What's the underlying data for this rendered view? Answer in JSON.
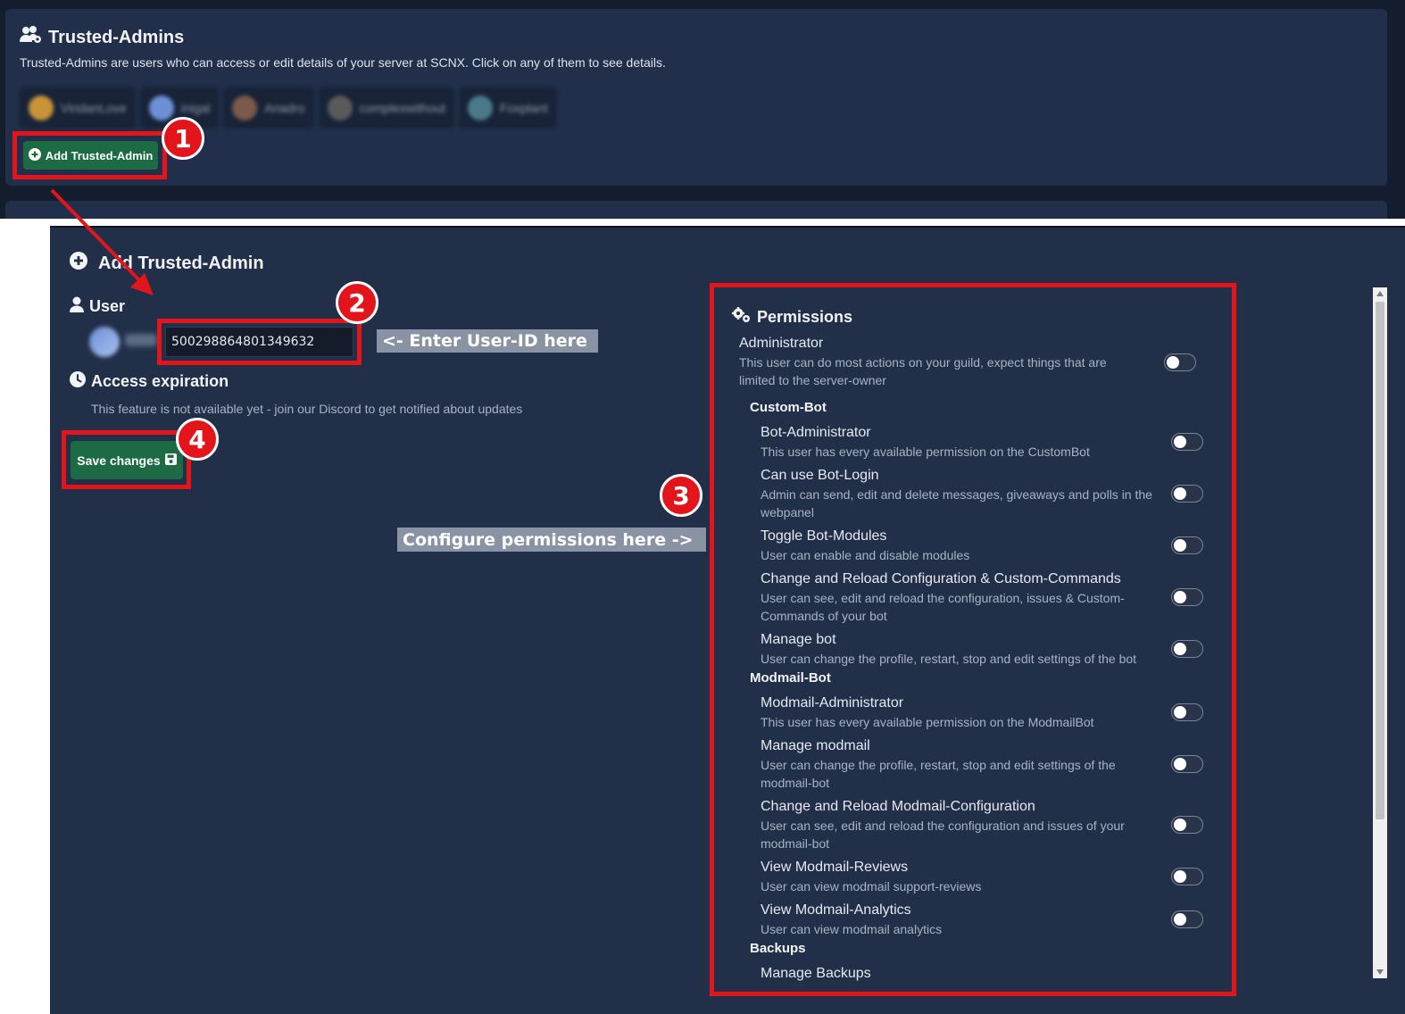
{
  "top": {
    "title": "Trusted-Admins",
    "description": "Trusted-Admins are users who can access or edit details of your server at SCNX. Click on any of them to see details.",
    "admins": [
      {
        "name": "ViridanLove",
        "avatar_color": "#c99438"
      },
      {
        "name": "inigal",
        "avatar_color": "#6d8fd6"
      },
      {
        "name": "Anadro",
        "avatar_color": "#7a5a4a"
      },
      {
        "name": "complexwithout",
        "avatar_color": "#5a5a5a"
      },
      {
        "name": "Foxplant",
        "avatar_color": "#4a7a8a"
      }
    ],
    "add_button": "Add Trusted-Admin"
  },
  "badges": {
    "one": "1",
    "two": "2",
    "three": "3",
    "four": "4"
  },
  "modal": {
    "title": "Add Trusted-Admin",
    "user_label": "User",
    "user_id": "500298864801349632",
    "access_label": "Access expiration",
    "access_note": "This feature is not available yet - join our Discord to get notified about updates",
    "save_button": "Save changes"
  },
  "callouts": {
    "enter_id": "<- Enter User-ID here",
    "configure": "Configure permissions here ->"
  },
  "permissions": {
    "heading": "Permissions",
    "administrator": {
      "name": "Administrator",
      "desc": "This user can do most actions on your guild, expect things that are limited to the server-owner"
    },
    "groups": {
      "custom_bot": "Custom-Bot",
      "modmail_bot": "Modmail-Bot",
      "backups": "Backups"
    },
    "custom_bot_items": [
      {
        "name": "Bot-Administrator",
        "desc": "This user has every available permission on the CustomBot"
      },
      {
        "name": "Can use Bot-Login",
        "desc": "Admin can send, edit and delete messages, giveaways and polls in the webpanel"
      },
      {
        "name": "Toggle Bot-Modules",
        "desc": "User can enable and disable modules"
      },
      {
        "name": "Change and Reload Configuration & Custom-Commands",
        "desc": "User can see, edit and reload the configuration, issues & Custom-Commands of your bot"
      },
      {
        "name": "Manage bot",
        "desc": "User can change the profile, restart, stop and edit settings of the bot"
      }
    ],
    "modmail_items": [
      {
        "name": "Modmail-Administrator",
        "desc": "This user has every available permission on the ModmailBot"
      },
      {
        "name": "Manage modmail",
        "desc": "User can change the profile, restart, stop and edit settings of the modmail-bot"
      },
      {
        "name": "Change and Reload Modmail-Configuration",
        "desc": "User can see, edit and reload the configuration and issues of your modmail-bot"
      },
      {
        "name": "View Modmail-Reviews",
        "desc": "User can view modmail support-reviews"
      },
      {
        "name": "View Modmail-Analytics",
        "desc": "User can view modmail analytics"
      }
    ],
    "backup_items": [
      {
        "name": "Manage Backups"
      }
    ]
  },
  "colors": {
    "accent_red": "#e3151a",
    "button_green": "#1c6b45",
    "panel": "#222f49"
  }
}
